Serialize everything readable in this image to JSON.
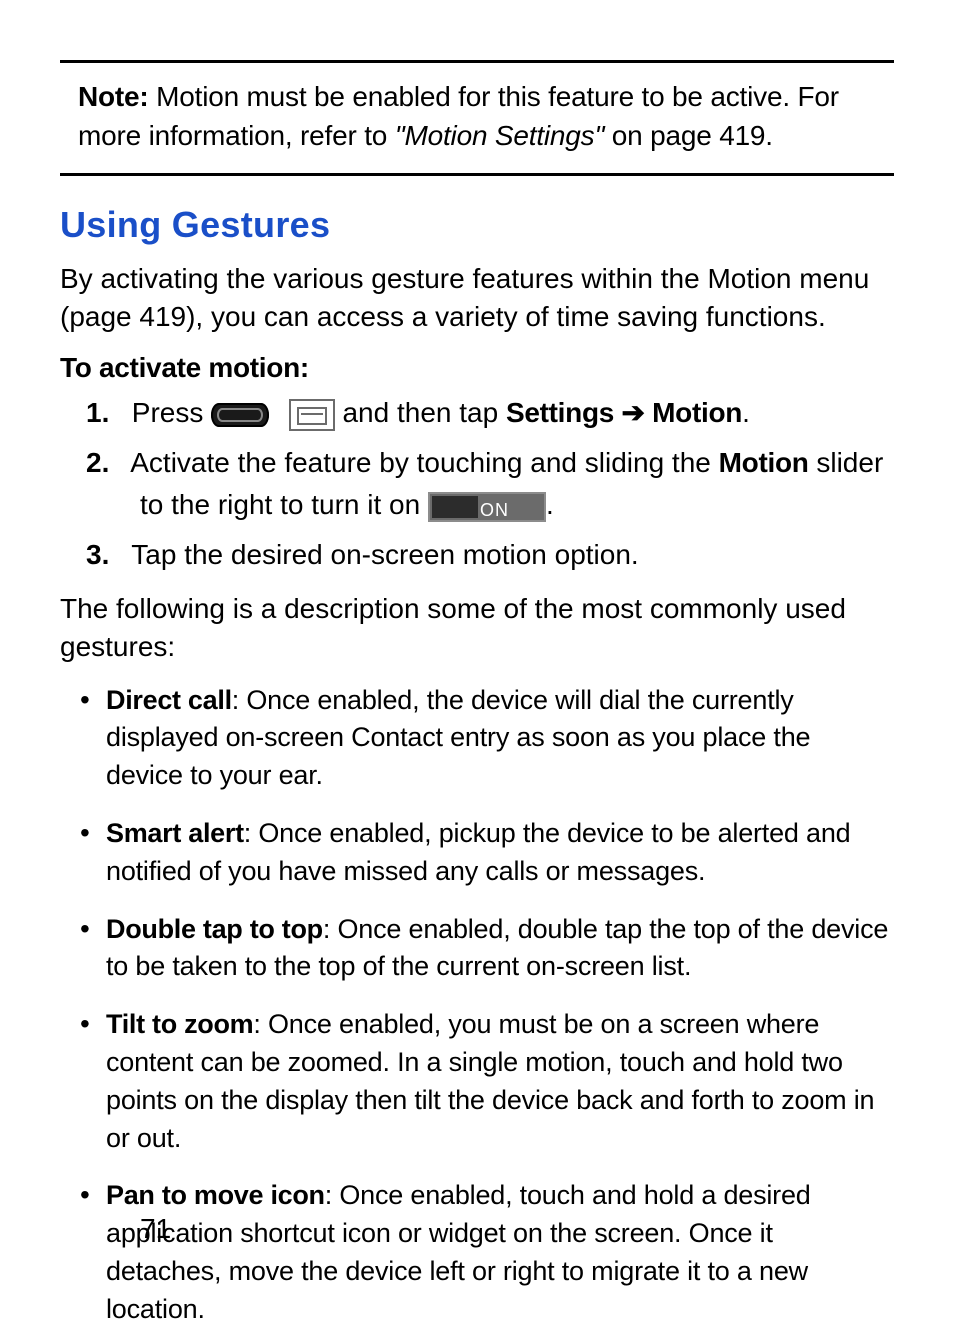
{
  "note": {
    "label": "Note:",
    "text_before_ref": "Motion must be enabled for this feature to be active. For more information, refer to ",
    "ref_italic": "\"Motion Settings\"",
    "text_after_ref": " on page 419."
  },
  "section": {
    "title": "Using Gestures",
    "intro": "By activating the various gesture features within the Motion menu (page 419), you can access a variety of time saving functions.",
    "subhead": "To activate motion:"
  },
  "steps": {
    "s1": {
      "press": "Press ",
      "and_then_tap": " and then tap ",
      "settings": "Settings",
      "arrow": " ➔ ",
      "motion": "Motion",
      "period": "."
    },
    "s2": {
      "before_bold": "Activate the feature by touching and sliding the ",
      "motion": "Motion",
      "after_bold_before_icon": " slider to the right to turn it on ",
      "on_label": "ON",
      "period": "."
    },
    "s3": "Tap the desired on-screen motion option."
  },
  "gestures_intro": "The following is a description some of the most commonly used gestures:",
  "bullets": {
    "b1": {
      "term": "Direct call",
      "desc": ": Once enabled, the device will dial the currently displayed on-screen Contact entry as soon as you place the device to your ear."
    },
    "b2": {
      "term": "Smart alert",
      "desc": ": Once enabled, pickup the device to be alerted and notified of you have missed any calls or messages."
    },
    "b3": {
      "term": "Double tap to top",
      "desc": ": Once enabled, double tap the top of the device to be taken to the top of the current on-screen list."
    },
    "b4": {
      "term": "Tilt to zoom",
      "desc": ": Once enabled, you must be on a screen where content can be zoomed. In a single motion, touch and hold two points on the display then tilt the device back and forth to zoom in or out."
    },
    "b5": {
      "term": "Pan to move icon",
      "desc": ": Once enabled, touch and hold a desired application shortcut icon or widget on the screen. Once it detaches, move the device left or right to migrate it to a new location."
    }
  },
  "page_number": "71"
}
